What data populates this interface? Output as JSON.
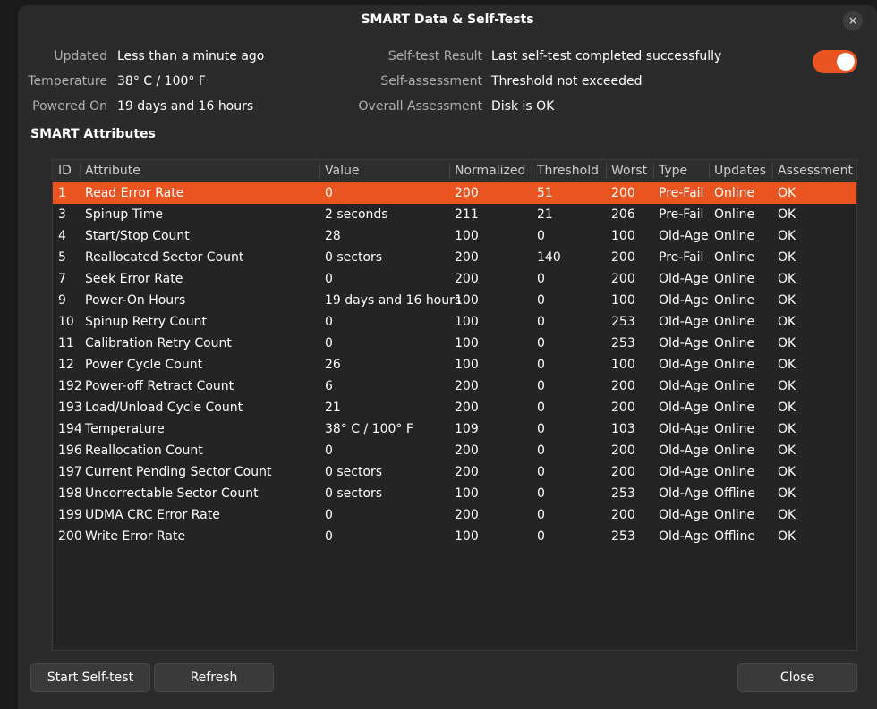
{
  "window": {
    "title": "SMART Data & Self-Tests",
    "close_icon": "×"
  },
  "summary_left": [
    {
      "label": "Updated",
      "value": "Less than a minute ago"
    },
    {
      "label": "Temperature",
      "value": "38° C / 100° F"
    },
    {
      "label": "Powered On",
      "value": "19 days and 16 hours"
    }
  ],
  "summary_right": [
    {
      "label": "Self-test Result",
      "value": "Last self-test completed successfully"
    },
    {
      "label": "Self-assessment",
      "value": "Threshold not exceeded"
    },
    {
      "label": "Overall Assessment",
      "value": "Disk is OK"
    }
  ],
  "smart_toggle": {
    "state": "on",
    "color": "#e95420"
  },
  "section_title": "SMART Attributes",
  "table": {
    "columns": [
      "ID",
      "Attribute",
      "Value",
      "Normalized",
      "Threshold",
      "Worst",
      "Type",
      "Updates",
      "Assessment"
    ],
    "rows": [
      [
        "1",
        "Read Error Rate",
        "0",
        "200",
        "51",
        "200",
        "Pre-Fail",
        "Online",
        "OK"
      ],
      [
        "3",
        "Spinup Time",
        "2 seconds",
        "211",
        "21",
        "206",
        "Pre-Fail",
        "Online",
        "OK"
      ],
      [
        "4",
        "Start/Stop Count",
        "28",
        "100",
        "0",
        "100",
        "Old-Age",
        "Online",
        "OK"
      ],
      [
        "5",
        "Reallocated Sector Count",
        "0 sectors",
        "200",
        "140",
        "200",
        "Pre-Fail",
        "Online",
        "OK"
      ],
      [
        "7",
        "Seek Error Rate",
        "0",
        "200",
        "0",
        "200",
        "Old-Age",
        "Online",
        "OK"
      ],
      [
        "9",
        "Power-On Hours",
        "19 days and 16 hours",
        "100",
        "0",
        "100",
        "Old-Age",
        "Online",
        "OK"
      ],
      [
        "10",
        "Spinup Retry Count",
        "0",
        "100",
        "0",
        "253",
        "Old-Age",
        "Online",
        "OK"
      ],
      [
        "11",
        "Calibration Retry Count",
        "0",
        "100",
        "0",
        "253",
        "Old-Age",
        "Online",
        "OK"
      ],
      [
        "12",
        "Power Cycle Count",
        "26",
        "100",
        "0",
        "100",
        "Old-Age",
        "Online",
        "OK"
      ],
      [
        "192",
        "Power-off Retract Count",
        "6",
        "200",
        "0",
        "200",
        "Old-Age",
        "Online",
        "OK"
      ],
      [
        "193",
        "Load/Unload Cycle Count",
        "21",
        "200",
        "0",
        "200",
        "Old-Age",
        "Online",
        "OK"
      ],
      [
        "194",
        "Temperature",
        "38° C / 100° F",
        "109",
        "0",
        "103",
        "Old-Age",
        "Online",
        "OK"
      ],
      [
        "196",
        "Reallocation Count",
        "0",
        "200",
        "0",
        "200",
        "Old-Age",
        "Online",
        "OK"
      ],
      [
        "197",
        "Current Pending Sector Count",
        "0 sectors",
        "200",
        "0",
        "200",
        "Old-Age",
        "Online",
        "OK"
      ],
      [
        "198",
        "Uncorrectable Sector Count",
        "0 sectors",
        "100",
        "0",
        "253",
        "Old-Age",
        "Offline",
        "OK"
      ],
      [
        "199",
        "UDMA CRC Error Rate",
        "0",
        "200",
        "0",
        "200",
        "Old-Age",
        "Online",
        "OK"
      ],
      [
        "200",
        "Write Error Rate",
        "0",
        "100",
        "0",
        "253",
        "Old-Age",
        "Offline",
        "OK"
      ]
    ],
    "selected_row": 0,
    "selection_color": "#e95420"
  },
  "buttons": {
    "start_self_test": "Start Self-test",
    "refresh": "Refresh",
    "close": "Close"
  }
}
